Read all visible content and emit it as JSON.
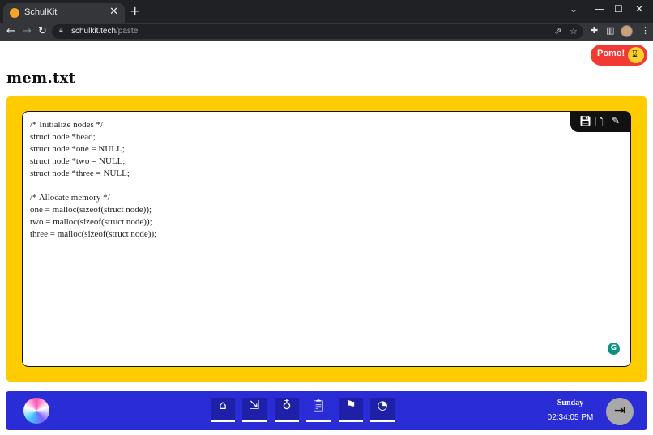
{
  "browser": {
    "tab_title": "SchulKit",
    "tab_close": "✕",
    "new_tab": "+",
    "url_host": "schulkit.tech",
    "url_path": "/paste",
    "icons": [
      "back-icon",
      "forward-icon",
      "reload-icon",
      "lock-icon",
      "share-icon",
      "star-icon",
      "extensions-icon",
      "sidepanel-icon",
      "profile-icon",
      "menu-icon"
    ]
  },
  "page": {
    "title": "mem.txt"
  },
  "pomo": {
    "label": "Pomo!",
    "icon": "hourglass-icon"
  },
  "editor": {
    "content": "/* Initialize nodes */\nstruct node *head;\nstruct node *one = NULL;\nstruct node *two = NULL;\nstruct node *three = NULL;\n\n/* Allocate memory */\none = malloc(sizeof(struct node));\ntwo = malloc(sizeof(struct node));\nthree = malloc(sizeof(struct node));",
    "tools": [
      "save-icon",
      "new-file-icon",
      "edit-file-icon"
    ]
  },
  "dock": {
    "items": [
      {
        "name": "home",
        "icon": "home-icon"
      },
      {
        "name": "click",
        "icon": "cursor-click-icon"
      },
      {
        "name": "planet",
        "icon": "planet-icon"
      },
      {
        "name": "paste",
        "icon": "clipboard-icon",
        "active": true
      },
      {
        "name": "goals",
        "icon": "flag-icon"
      },
      {
        "name": "timer",
        "icon": "timer-icon"
      }
    ],
    "day": "Sunday",
    "time": "02:34:05 PM"
  },
  "colors": {
    "accent_yellow": "#ffcc00",
    "dock_blue": "#2a2dd6",
    "pomo_red": "#f13a33"
  }
}
